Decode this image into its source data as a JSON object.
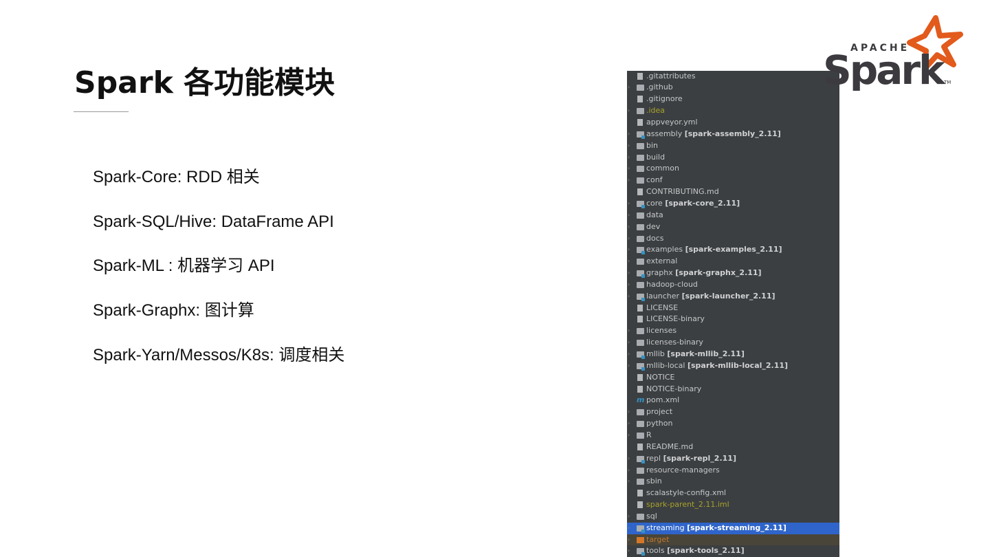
{
  "slide": {
    "title": "Spark 各功能模块"
  },
  "bullets": [
    "Spark-Core: RDD  相关",
    "Spark-SQL/Hive:   DataFrame API",
    "Spark-ML :   机器学习 API",
    "Spark-Graphx:  图计算",
    "Spark-Yarn/Messos/K8s:  调度相关"
  ],
  "logo": {
    "text_top": "APACHE",
    "text_main": "Spark",
    "tm": "TM"
  },
  "colors": {
    "panel": "#3c3f41",
    "selected": "#2f65ca",
    "logo_orange": "#e25a1c",
    "logo_gray": "#3c3a3e"
  },
  "tree": [
    {
      "name": ".gitattributes",
      "icon": "file"
    },
    {
      "name": ".github",
      "icon": "folder",
      "exp": true
    },
    {
      "name": ".gitignore",
      "icon": "file"
    },
    {
      "name": ".idea",
      "icon": "folder",
      "exp": true,
      "color": "olive"
    },
    {
      "name": "appveyor.yml",
      "icon": "file"
    },
    {
      "name": "assembly",
      "module": "[spark-assembly_2.11]",
      "icon": "module",
      "exp": true
    },
    {
      "name": "bin",
      "icon": "folder",
      "exp": true
    },
    {
      "name": "build",
      "icon": "folder",
      "exp": true
    },
    {
      "name": "common",
      "icon": "folder",
      "exp": true
    },
    {
      "name": "conf",
      "icon": "folder",
      "exp": true
    },
    {
      "name": "CONTRIBUTING.md",
      "icon": "file"
    },
    {
      "name": "core",
      "module": "[spark-core_2.11]",
      "icon": "module",
      "exp": true
    },
    {
      "name": "data",
      "icon": "folder",
      "exp": true
    },
    {
      "name": "dev",
      "icon": "folder",
      "exp": true
    },
    {
      "name": "docs",
      "icon": "folder",
      "exp": true
    },
    {
      "name": "examples",
      "module": "[spark-examples_2.11]",
      "icon": "module",
      "exp": true
    },
    {
      "name": "external",
      "icon": "folder",
      "exp": true
    },
    {
      "name": "graphx",
      "module": "[spark-graphx_2.11]",
      "icon": "module",
      "exp": true
    },
    {
      "name": "hadoop-cloud",
      "icon": "folder",
      "exp": true
    },
    {
      "name": "launcher",
      "module": "[spark-launcher_2.11]",
      "icon": "module",
      "exp": true
    },
    {
      "name": "LICENSE",
      "icon": "file"
    },
    {
      "name": "LICENSE-binary",
      "icon": "file"
    },
    {
      "name": "licenses",
      "icon": "folder",
      "exp": true
    },
    {
      "name": "licenses-binary",
      "icon": "folder",
      "exp": true
    },
    {
      "name": "mllib",
      "module": "[spark-mllib_2.11]",
      "icon": "module",
      "exp": true
    },
    {
      "name": "mllib-local",
      "module": "[spark-mllib-local_2.11]",
      "icon": "module",
      "exp": true
    },
    {
      "name": "NOTICE",
      "icon": "file"
    },
    {
      "name": "NOTICE-binary",
      "icon": "file"
    },
    {
      "name": "pom.xml",
      "icon": "maven"
    },
    {
      "name": "project",
      "icon": "folder",
      "exp": true
    },
    {
      "name": "python",
      "icon": "folder",
      "exp": true
    },
    {
      "name": "R",
      "icon": "folder",
      "exp": true
    },
    {
      "name": "README.md",
      "icon": "file"
    },
    {
      "name": "repl",
      "module": "[spark-repl_2.11]",
      "icon": "module",
      "exp": true
    },
    {
      "name": "resource-managers",
      "icon": "folder",
      "exp": true
    },
    {
      "name": "sbin",
      "icon": "folder",
      "exp": true
    },
    {
      "name": "scalastyle-config.xml",
      "icon": "file"
    },
    {
      "name": "spark-parent_2.11.iml",
      "icon": "file",
      "color": "olive"
    },
    {
      "name": "sql",
      "icon": "folder",
      "exp": true
    },
    {
      "name": "streaming",
      "module": "[spark-streaming_2.11]",
      "icon": "module",
      "exp": true,
      "selected": true
    },
    {
      "name": "target",
      "icon": "target",
      "exp": true,
      "color": "orange"
    },
    {
      "name": "tools",
      "module": "[spark-tools_2.11]",
      "icon": "module",
      "exp": true
    }
  ]
}
